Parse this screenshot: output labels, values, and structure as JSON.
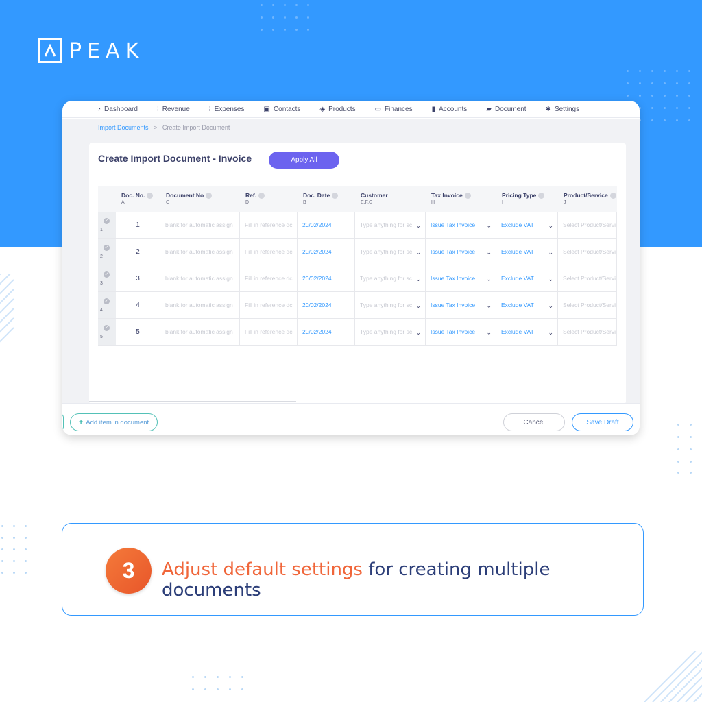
{
  "brand": {
    "name": "PEAK"
  },
  "nav": {
    "items": [
      {
        "label": "Dashboard",
        "icon": "dashboard-icon"
      },
      {
        "label": "Revenue",
        "icon": "revenue-icon"
      },
      {
        "label": "Expenses",
        "icon": "expenses-icon"
      },
      {
        "label": "Contacts",
        "icon": "contacts-icon"
      },
      {
        "label": "Products",
        "icon": "box-icon"
      },
      {
        "label": "Finances",
        "icon": "money-icon"
      },
      {
        "label": "Accounts",
        "icon": "book-icon"
      },
      {
        "label": "Document",
        "icon": "folder-icon"
      },
      {
        "label": "Settings",
        "icon": "gear-icon"
      }
    ]
  },
  "breadcrumb": {
    "parent": "Import Documents",
    "separator": ">",
    "current": "Create Import Document"
  },
  "page": {
    "title": "Create Import Document - Invoice",
    "apply_all": "Apply All"
  },
  "table": {
    "headers": [
      {
        "label": "Doc. No.",
        "col": "A",
        "help": true
      },
      {
        "label": "Document No",
        "col": "C",
        "help": true
      },
      {
        "label": "Ref.",
        "col": "D",
        "help": true
      },
      {
        "label": "Doc. Date",
        "col": "B",
        "help": true
      },
      {
        "label": "Customer",
        "col": "E,F,G",
        "help": false
      },
      {
        "label": "Tax Invoice",
        "col": "H",
        "help": true
      },
      {
        "label": "Pricing Type",
        "col": "I",
        "help": true
      },
      {
        "label": "Product/Service",
        "col": "J",
        "help": true
      }
    ],
    "rows": [
      {
        "row_num": "1",
        "doc_no": "1",
        "document_no": "blank for automatic assign",
        "ref": "Fill in reference dc",
        "doc_date": "20/02/2024",
        "customer": "Type anything for sc",
        "tax_invoice": "Issue Tax Invoice",
        "pricing_type": "Exclude VAT",
        "product": "Select Product/Servic"
      },
      {
        "row_num": "2",
        "doc_no": "2",
        "document_no": "blank for automatic assign",
        "ref": "Fill in reference dc",
        "doc_date": "20/02/2024",
        "customer": "Type anything for sc",
        "tax_invoice": "Issue Tax Invoice",
        "pricing_type": "Exclude VAT",
        "product": "Select Product/Servic"
      },
      {
        "row_num": "3",
        "doc_no": "3",
        "document_no": "blank for automatic assign",
        "ref": "Fill in reference dc",
        "doc_date": "20/02/2024",
        "customer": "Type anything for sc",
        "tax_invoice": "Issue Tax Invoice",
        "pricing_type": "Exclude VAT",
        "product": "Select Product/Servic"
      },
      {
        "row_num": "4",
        "doc_no": "4",
        "document_no": "blank for automatic assign",
        "ref": "Fill in reference dc",
        "doc_date": "20/02/2024",
        "customer": "Type anything for sc",
        "tax_invoice": "Issue Tax Invoice",
        "pricing_type": "Exclude VAT",
        "product": "Select Product/Servic"
      },
      {
        "row_num": "5",
        "doc_no": "5",
        "document_no": "blank for automatic assign",
        "ref": "Fill in reference dc",
        "doc_date": "20/02/2024",
        "customer": "Type anything for sc",
        "tax_invoice": "Issue Tax Invoice",
        "pricing_type": "Exclude VAT",
        "product": "Select Product/Servic"
      }
    ]
  },
  "footer": {
    "add_item": "Add item in document",
    "cancel": "Cancel",
    "save_draft": "Save Draft"
  },
  "callout": {
    "step": "3",
    "highlight": "Adjust default settings",
    "rest": " for creating multiple documents"
  },
  "colors": {
    "brand_blue": "#3399ff",
    "apply_purple": "#6c63ef",
    "step_orange": "#f0663a",
    "text_navy": "#2c3e78"
  }
}
